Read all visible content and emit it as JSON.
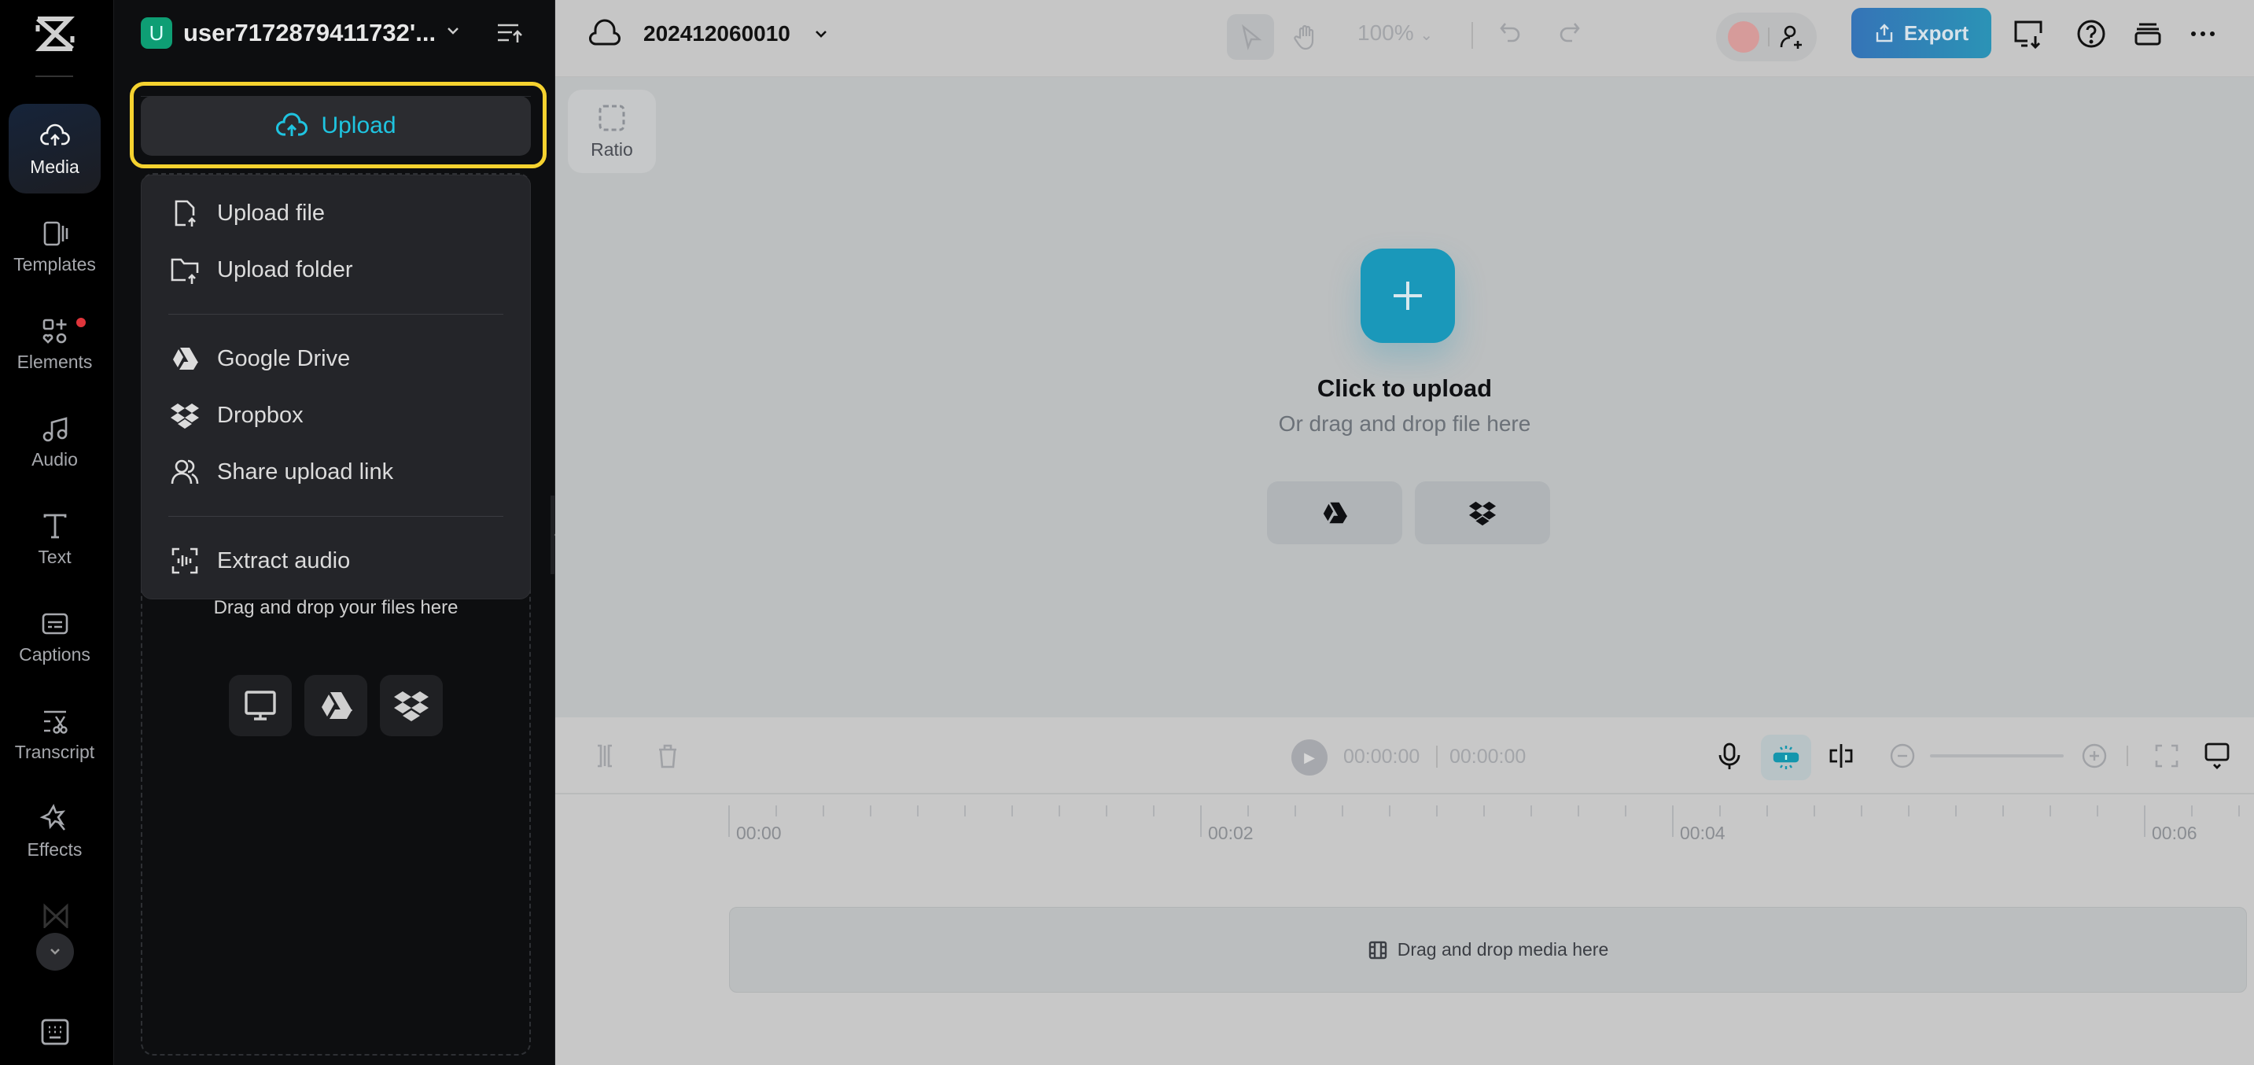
{
  "rail": {
    "items": [
      {
        "label": "Media",
        "icon": "cloud-upload-icon",
        "active": true
      },
      {
        "label": "Templates",
        "icon": "templates-icon"
      },
      {
        "label": "Elements",
        "icon": "elements-icon",
        "badge": true
      },
      {
        "label": "Audio",
        "icon": "music-note-icon"
      },
      {
        "label": "Text",
        "icon": "text-icon"
      },
      {
        "label": "Captions",
        "icon": "captions-icon"
      },
      {
        "label": "Transcript",
        "icon": "transcript-icon"
      },
      {
        "label": "Effects",
        "icon": "effects-icon"
      }
    ]
  },
  "panel": {
    "account_initial": "U",
    "account_name": "user7172879411732'...",
    "upload_label": "Upload",
    "dropzone_text": "Drag and drop your files here",
    "menu": {
      "items": [
        {
          "label": "Upload file",
          "icon": "upload-file-icon"
        },
        {
          "label": "Upload folder",
          "icon": "upload-folder-icon"
        },
        {
          "label": "Google Drive",
          "icon": "google-drive-icon"
        },
        {
          "label": "Dropbox",
          "icon": "dropbox-icon"
        },
        {
          "label": "Share upload link",
          "icon": "share-link-icon"
        },
        {
          "label": "Extract audio",
          "icon": "extract-audio-icon"
        }
      ]
    }
  },
  "topbar": {
    "project_name": "202412060010",
    "zoom_level": "100%",
    "export_label": "Export"
  },
  "canvas": {
    "ratio_label": "Ratio",
    "click_to_upload": "Click to upload",
    "drag_hint": "Or drag and drop file here"
  },
  "timeline": {
    "current_time": "00:00:00",
    "total_time": "00:00:00",
    "ruler_labels": [
      "00:00",
      "00:02",
      "00:04",
      "00:06"
    ],
    "track_hint": "Drag and drop media here"
  },
  "colors": {
    "accent": "#1fc4e0",
    "highlight": "#f5d22f",
    "export_start": "#3574b7",
    "export_end": "#2b93b6",
    "upload_plus": "#1a98ba"
  }
}
